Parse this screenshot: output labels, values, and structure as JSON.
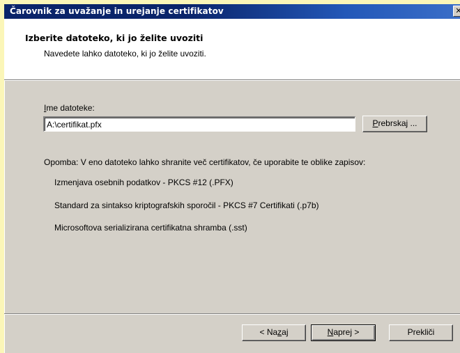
{
  "window": {
    "title": "Čarovnik za uvažanje in urejanje certifikatov",
    "close_glyph": "✕"
  },
  "header": {
    "title": "Izberite datoteko, ki jo želite uvoziti",
    "subtitle": "Navedete lahko datoteko, ki jo želite uvoziti."
  },
  "file": {
    "label_prefix": "I",
    "label_rest": "me datoteke:",
    "value": "A:\\certifikat.pfx",
    "browse_prefix": "P",
    "browse_rest": "rebrskaj ..."
  },
  "note": "Opomba: V eno datoteko lahko shranite več certifikatov, če uporabite te oblike zapisov:",
  "formats": [
    "Izmenjava osebnih podatkov - PKCS #12 (.PFX)",
    "Standard za sintakso kriptografskih sporočil - PKCS #7 Certifikati (.p7b)",
    "Microsoftova serializirana certifikatna shramba (.sst)"
  ],
  "footer": {
    "back_a": "< Na",
    "back_u": "z",
    "back_b": "aj",
    "next_u": "N",
    "next_rest": "aprej >",
    "cancel": "Prekliči"
  }
}
